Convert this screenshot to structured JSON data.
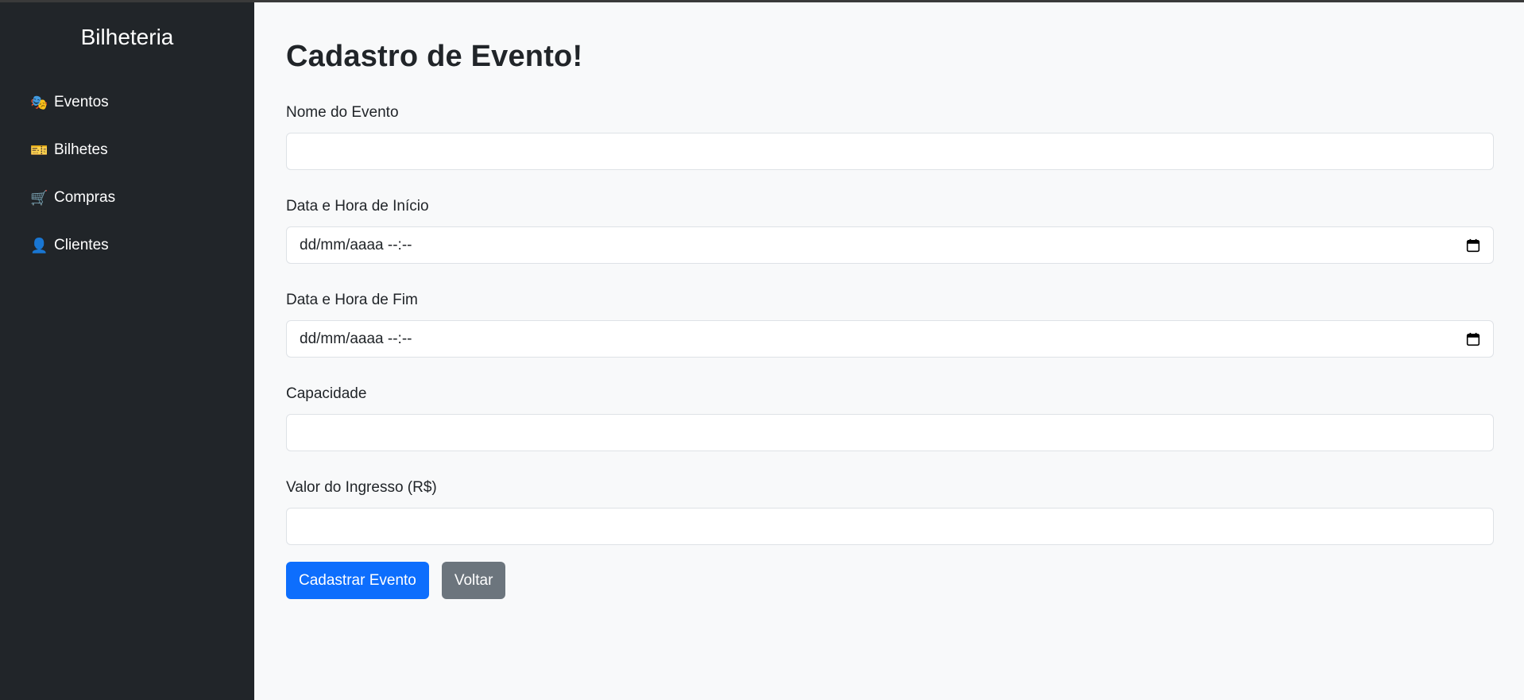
{
  "sidebar": {
    "brand": "Bilheteria",
    "items": [
      {
        "label": "Eventos",
        "icon": "theater-masks-icon",
        "glyph": "🎭"
      },
      {
        "label": "Bilhetes",
        "icon": "ticket-icon",
        "glyph": "🎫"
      },
      {
        "label": "Compras",
        "icon": "shopping-cart-icon",
        "glyph": "🛒"
      },
      {
        "label": "Clientes",
        "icon": "person-icon",
        "glyph": "👤"
      }
    ]
  },
  "main": {
    "title": "Cadastro de Evento!",
    "fields": {
      "nome": {
        "label": "Nome do Evento",
        "value": ""
      },
      "inicio": {
        "label": "Data e Hora de Início",
        "value": "dd/mm/aaaa --:--"
      },
      "fim": {
        "label": "Data e Hora de Fim",
        "value": "dd/mm/aaaa --:--"
      },
      "capacidade": {
        "label": "Capacidade",
        "value": ""
      },
      "valor": {
        "label": "Valor do Ingresso (R$)",
        "value": ""
      }
    },
    "buttons": {
      "submit": "Cadastrar Evento",
      "back": "Voltar"
    }
  },
  "colors": {
    "sidebar_bg": "#212529",
    "main_bg": "#f8f9fa",
    "primary": "#0d6efd",
    "secondary": "#6c757d"
  }
}
